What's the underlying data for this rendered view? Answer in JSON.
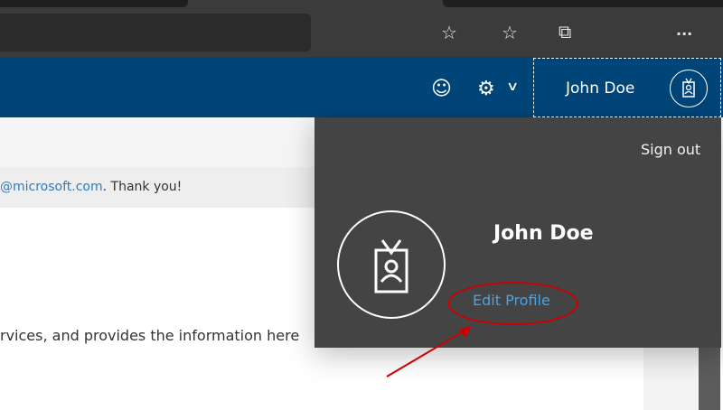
{
  "browser": {
    "icons": [
      "favorite-add-icon",
      "favorites-icon",
      "collections-icon",
      "more-icon"
    ],
    "more_label": "..."
  },
  "header": {
    "user_name": "John Doe",
    "icons": [
      "smiley-icon",
      "gear-icon",
      "chevron-down-icon"
    ]
  },
  "page": {
    "notice_link": "@microsoft.com",
    "notice_rest": ". Thank you!",
    "body_text": "rvices, and provides the information here"
  },
  "profile_menu": {
    "sign_out": "Sign out",
    "name": "John Doe",
    "edit_profile": "Edit Profile"
  },
  "annotation_color": "#cc0000"
}
